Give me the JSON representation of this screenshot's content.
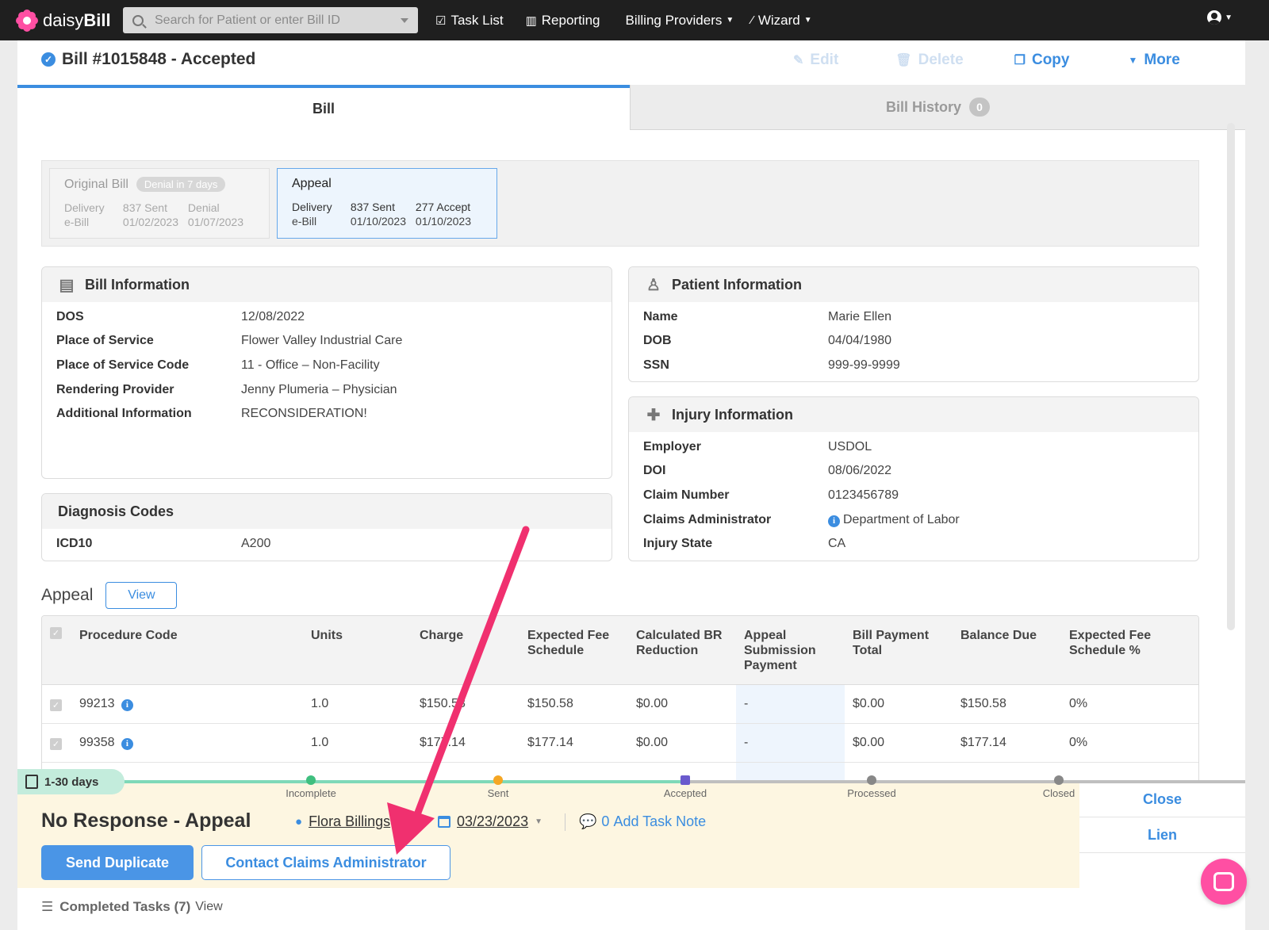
{
  "nav": {
    "logo_text_light": "daisy",
    "logo_text_bold": "Bill",
    "search_placeholder": "Search for Patient or enter Bill ID",
    "items": [
      {
        "label": "Task List",
        "icon": "task-icon"
      },
      {
        "label": "Reporting",
        "icon": "chart-icon"
      },
      {
        "label": "Billing Providers",
        "icon": ""
      },
      {
        "label": "Wizard",
        "icon": "wand-icon"
      }
    ]
  },
  "bill": {
    "title": "Bill #1015848 - Accepted",
    "actions": {
      "edit": "Edit",
      "delete": "Delete",
      "copy": "Copy",
      "more": "More"
    }
  },
  "tabs": {
    "bill": "Bill",
    "history": "Bill History",
    "history_count": "0"
  },
  "versions": {
    "original": {
      "title": "Original Bill",
      "badge": "Denial in 7 days",
      "delivery_label": "Delivery",
      "delivery_value": "e-Bill",
      "sent_label": "837 Sent",
      "sent_date": "01/02/2023",
      "status_label": "Denial",
      "status_date": "01/07/2023"
    },
    "appeal": {
      "title": "Appeal",
      "delivery_label": "Delivery",
      "delivery_value": "e-Bill",
      "sent_label": "837 Sent",
      "sent_date": "01/10/2023",
      "status_label": "277 Accept",
      "status_date": "01/10/2023"
    }
  },
  "bill_info": {
    "heading": "Bill Information",
    "rows": [
      {
        "k": "DOS",
        "v": "12/08/2022"
      },
      {
        "k": "Place of Service",
        "v": "Flower Valley Industrial Care"
      },
      {
        "k": "Place of Service Code",
        "v": "11 - Office – Non-Facility"
      },
      {
        "k": "Rendering Provider",
        "v": "Jenny Plumeria – Physician"
      },
      {
        "k": "Additional Information",
        "v": "RECONSIDERATION!"
      }
    ]
  },
  "patient_info": {
    "heading": "Patient Information",
    "rows": [
      {
        "k": "Name",
        "v": "Marie Ellen"
      },
      {
        "k": "DOB",
        "v": "04/04/1980"
      },
      {
        "k": "SSN",
        "v": "999-99-9999"
      }
    ]
  },
  "injury_info": {
    "heading": "Injury Information",
    "rows": [
      {
        "k": "Employer",
        "v": "USDOL"
      },
      {
        "k": "DOI",
        "v": "08/06/2022"
      },
      {
        "k": "Claim Number",
        "v": "0123456789"
      },
      {
        "k": "Claims Administrator",
        "v": "Department of Labor"
      },
      {
        "k": "Injury State",
        "v": "CA"
      }
    ]
  },
  "diagnosis": {
    "heading": "Diagnosis Codes",
    "code_type": "ICD10",
    "code": "A200"
  },
  "appeal_table": {
    "title": "Appeal",
    "view_label": "View",
    "headers": [
      "Procedure Code",
      "Units",
      "Charge",
      "Expected Fee Schedule",
      "Calculated BR Reduction",
      "Appeal Submission Payment",
      "Bill Payment Total",
      "Balance Due",
      "Expected Fee Schedule %"
    ],
    "rows": [
      [
        "99213",
        "1.0",
        "$150.58",
        "$150.58",
        "$0.00",
        "-",
        "$0.00",
        "$150.58",
        "0%"
      ],
      [
        "99358",
        "1.0",
        "$177.14",
        "$177.14",
        "$0.00",
        "-",
        "$0.00",
        "$177.14",
        "0%"
      ]
    ]
  },
  "task": {
    "days_label": "1-30 days",
    "stages": [
      {
        "label": "Incomplete",
        "color": "#3fbf7f"
      },
      {
        "label": "Sent",
        "color": "#f5a623"
      },
      {
        "label": "Accepted",
        "color": "#6a5acd"
      },
      {
        "label": "Processed",
        "color": "#888888"
      },
      {
        "label": "Closed",
        "color": "#888888"
      }
    ],
    "title": "No Response - Appeal",
    "assignee": "Flora Billings",
    "due_date": "03/23/2023",
    "note_count": "0",
    "note_label": "Add Task Note",
    "primary_button": "Send Duplicate",
    "secondary_button": "Contact Claims Administrator",
    "side_options": [
      "Close",
      "Lien"
    ],
    "completed_label": "Completed Tasks (7)",
    "completed_view": "View"
  },
  "colors": {
    "accent": "#3b8de0",
    "topnav": "#1f1f1f",
    "task_bg": "#fdf6e1",
    "chat": "#ff4fa3"
  }
}
